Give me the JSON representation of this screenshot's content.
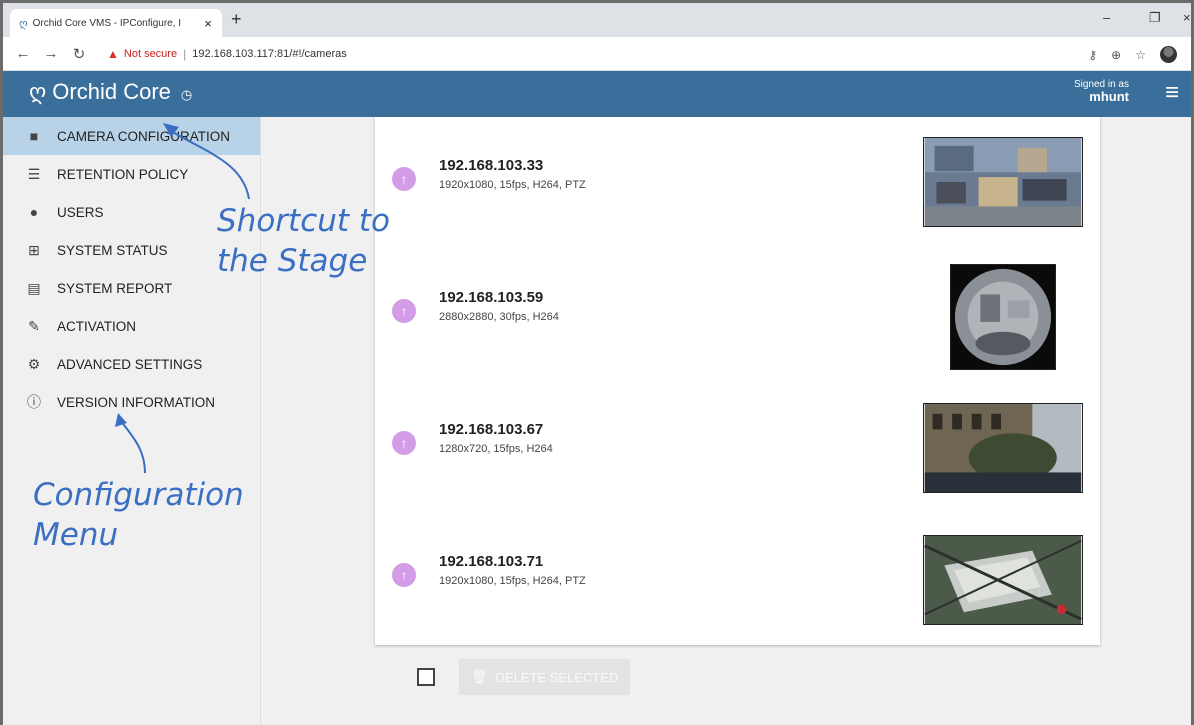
{
  "browser": {
    "tab_title": "Orchid Core VMS - IPConfigure, I",
    "tab_close": "×",
    "new_tab": "+",
    "not_secure": "Not secure",
    "url": "192.168.103.117:81/#!/cameras"
  },
  "app": {
    "title": "Orchid Core",
    "signed_in_as": "Signed in as",
    "username": "mhunt"
  },
  "sidebar": {
    "items": [
      {
        "label": "CAMERA CONFIGURATION",
        "icon": "camera-icon"
      },
      {
        "label": "RETENTION POLICY",
        "icon": "database-icon"
      },
      {
        "label": "USERS",
        "icon": "user-icon"
      },
      {
        "label": "SYSTEM STATUS",
        "icon": "medkit-icon"
      },
      {
        "label": "SYSTEM REPORT",
        "icon": "report-icon"
      },
      {
        "label": "ACTIVATION",
        "icon": "plug-icon"
      },
      {
        "label": "ADVANCED SETTINGS",
        "icon": "gears-icon"
      },
      {
        "label": "VERSION INFORMATION",
        "icon": "info-icon"
      }
    ]
  },
  "cameras": [
    {
      "ip": "192.168.103.33",
      "spec": "1920x1080, 15fps, H264, PTZ"
    },
    {
      "ip": "192.168.103.59",
      "spec": "2880x2880, 30fps, H264"
    },
    {
      "ip": "192.168.103.67",
      "spec": "1280x720, 15fps, H264"
    },
    {
      "ip": "192.168.103.71",
      "spec": "1920x1080, 15fps, H264, PTZ"
    }
  ],
  "actions": {
    "delete_selected": "DELETE SELECTED"
  },
  "annotations": {
    "shortcut_line1": "Shortcut to",
    "shortcut_line2": "the Stage",
    "config_line1": "Configuration",
    "config_line2": "Menu"
  },
  "colors": {
    "header": "#3b6f9b",
    "active_menu": "#b8d3e7",
    "upload_button": "#d49be6",
    "annotation": "#3b6fc4"
  }
}
